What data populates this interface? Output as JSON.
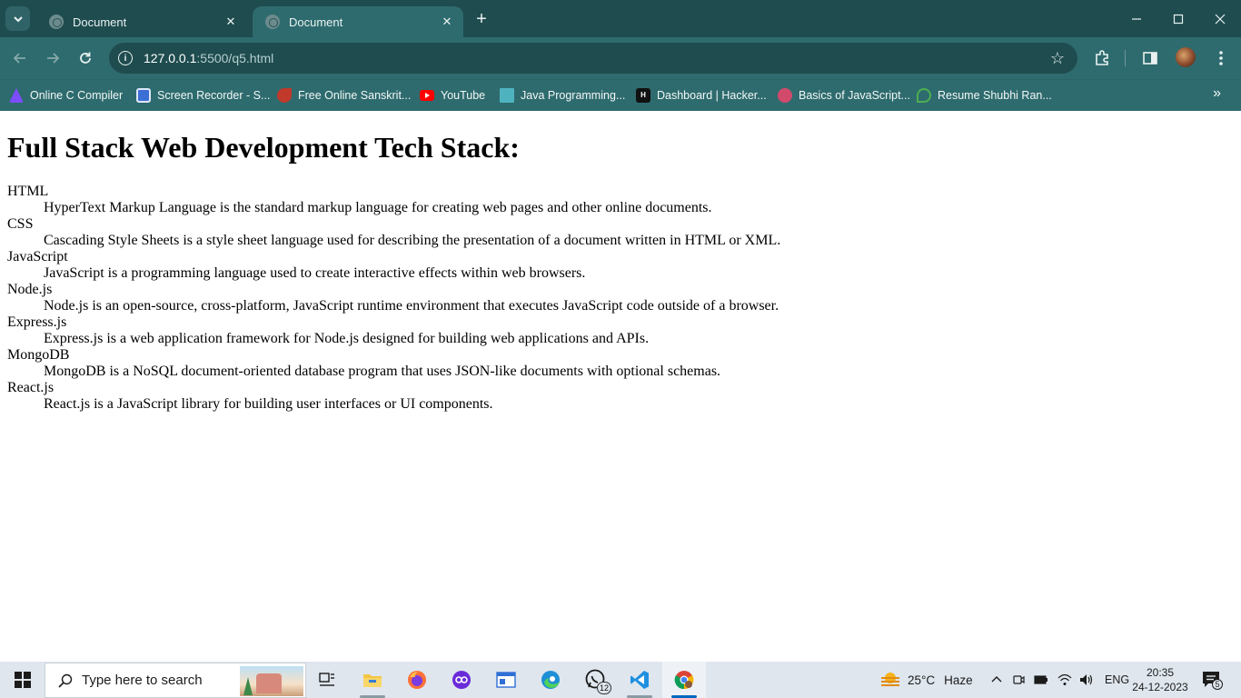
{
  "browser": {
    "tabs": [
      {
        "title": "Document",
        "active": false
      },
      {
        "title": "Document",
        "active": true
      }
    ],
    "address": {
      "host": "127.0.0.1",
      "path": ":5500/q5.html"
    },
    "bookmarks": [
      {
        "label": "Online C Compiler",
        "icon": "compiler-icon",
        "color": "#7c4dff"
      },
      {
        "label": "Screen Recorder - S...",
        "icon": "screen-recorder-icon",
        "color": "#3b6fd6"
      },
      {
        "label": "Free Online Sanskrit...",
        "icon": "sanskrit-icon",
        "color": "#c0392b"
      },
      {
        "label": "YouTube",
        "icon": "youtube-icon",
        "color": "#ff0000"
      },
      {
        "label": "Java Programming...",
        "icon": "java-icon",
        "color": "#4fb3bf"
      },
      {
        "label": "Dashboard | Hacker...",
        "icon": "hackerrank-icon",
        "color": "#111111"
      },
      {
        "label": "Basics of JavaScript...",
        "icon": "javascript-course-icon",
        "color": "#d24a6b"
      },
      {
        "label": "Resume Shubhi Ran...",
        "icon": "resume-icon",
        "color": "#4caf50"
      }
    ]
  },
  "page": {
    "heading": "Full Stack Web Development Tech Stack:",
    "terms": [
      {
        "term": "HTML",
        "definition": "HyperText Markup Language is the standard markup language for creating web pages and other online documents."
      },
      {
        "term": "CSS",
        "definition": "Cascading Style Sheets is a style sheet language used for describing the presentation of a document written in HTML or XML."
      },
      {
        "term": "JavaScript",
        "definition": "JavaScript is a programming language used to create interactive effects within web browsers."
      },
      {
        "term": "Node.js",
        "definition": "Node.js is an open-source, cross-platform, JavaScript runtime environment that executes JavaScript code outside of a browser."
      },
      {
        "term": "Express.js",
        "definition": "Express.js is a web application framework for Node.js designed for building web applications and APIs."
      },
      {
        "term": "MongoDB",
        "definition": "MongoDB is a NoSQL document-oriented database program that uses JSON-like documents with optional schemas."
      },
      {
        "term": "React.js",
        "definition": "React.js is a JavaScript library for building user interfaces or UI components."
      }
    ]
  },
  "taskbar": {
    "search_placeholder": "Type here to search",
    "apps": [
      {
        "name": "task-view",
        "running": false
      },
      {
        "name": "file-explorer",
        "running": true
      },
      {
        "name": "firefox",
        "running": false
      },
      {
        "name": "media-app",
        "running": false
      },
      {
        "name": "notepad",
        "running": false
      },
      {
        "name": "edge",
        "running": false
      },
      {
        "name": "whatsapp",
        "running": false,
        "badge": "12"
      },
      {
        "name": "vscode",
        "running": true
      },
      {
        "name": "chrome",
        "running": true,
        "active": true
      }
    ],
    "weather": {
      "temp": "25°C",
      "condition": "Haze"
    },
    "language": "ENG",
    "time": "20:35",
    "date": "24-12-2023",
    "notifications": "5"
  }
}
